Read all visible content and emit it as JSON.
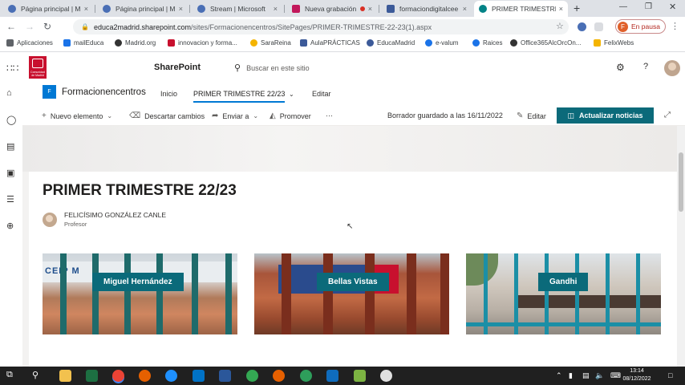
{
  "browser": {
    "tabs": [
      {
        "title": "Página principal | M",
        "color": "#4a6fb5"
      },
      {
        "title": "Página principal | M",
        "color": "#4a6fb5"
      },
      {
        "title": "Stream | Microsoft",
        "color": "#4a6fb5"
      },
      {
        "title": "Nueva grabación",
        "color": "#c2185b"
      },
      {
        "title": "formaciondigitalcee",
        "color": "#3c5a99"
      },
      {
        "title": "PRIMER TRIMESTRE",
        "color": "#038387"
      }
    ],
    "close_glyph": "×",
    "new_tab_glyph": "+",
    "url_host": "educa2madrid.sharepoint.com",
    "url_path": "/sites/Formacionencentros/SitePages/PRIMER-TRIMESTRE-22-23(1).aspx",
    "profile_initial": "F",
    "profile_label": "En pausa",
    "bookmarks": [
      {
        "label": "Aplicaciones",
        "color": "#5f6368"
      },
      {
        "label": "mailEduca",
        "color": "#1a73e8"
      },
      {
        "label": "Madrid.org",
        "color": "#333333"
      },
      {
        "label": "innovacion y forma...",
        "color": "#c8102e"
      },
      {
        "label": "SaraReina",
        "color": "#f4b400"
      },
      {
        "label": "AulaPRÁCTICAS",
        "color": "#3c5a99"
      },
      {
        "label": "EducaMadrid",
        "color": "#3c5a99"
      },
      {
        "label": "e-valum",
        "color": "#1a73e8"
      },
      {
        "label": "Raices",
        "color": "#1a73e8"
      },
      {
        "label": "Office365AlcOrcOn...",
        "color": "#333333"
      },
      {
        "label": "FelixWebs",
        "color": "#f4b400"
      }
    ]
  },
  "suite": {
    "brand": "SharePoint",
    "search_placeholder": "Buscar en este sitio",
    "logo_text": "Comunidad de Madrid"
  },
  "site": {
    "icon_letter": "F",
    "name": "Formacionencentros",
    "nav": [
      "Inicio",
      "PRIMER TRIMESTRE 22/23",
      "Editar"
    ]
  },
  "commandbar": {
    "new_item": "Nuevo elemento",
    "discard": "Descartar cambios",
    "send": "Enviar a",
    "promote": "Promover",
    "more": "···",
    "status": "Borrador guardado a las 16/11/2022",
    "edit": "Editar",
    "publish": "Actualizar noticias"
  },
  "page": {
    "title": "PRIMER TRIMESTRE 22/23",
    "author_name": "FELICÍSIMO GONZÁLEZ CANLE",
    "author_role": "Profesor",
    "cards": [
      {
        "label": "Miguel Hernández",
        "sign": "CEIP M"
      },
      {
        "label": "Bellas Vistas"
      },
      {
        "label": "Gandhi"
      }
    ]
  },
  "taskbar": {
    "time": "13:14",
    "date": "08/12/2022"
  },
  "colors": {
    "accent": "#0078d4",
    "teal": "#0b6a7a"
  }
}
